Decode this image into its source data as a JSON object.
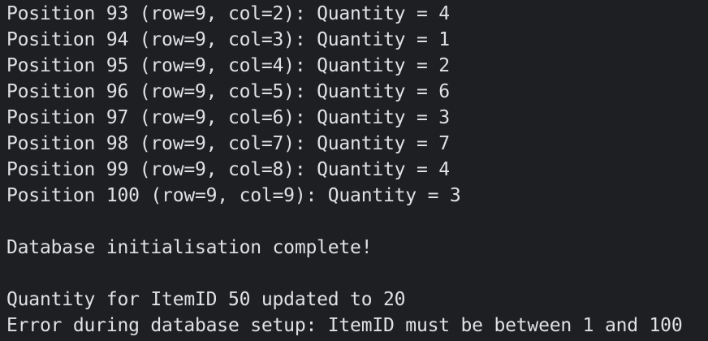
{
  "console": {
    "lines": [
      "Position 93 (row=9, col=2): Quantity = 4",
      "Position 94 (row=9, col=3): Quantity = 1",
      "Position 95 (row=9, col=4): Quantity = 2",
      "Position 96 (row=9, col=5): Quantity = 6",
      "Position 97 (row=9, col=6): Quantity = 3",
      "Position 98 (row=9, col=7): Quantity = 7",
      "Position 99 (row=9, col=8): Quantity = 4",
      "Position 100 (row=9, col=9): Quantity = 3",
      "",
      "Database initialisation complete!",
      "",
      "Quantity for ItemID 50 updated to 20",
      "Error during database setup: ItemID must be between 1 and 100"
    ],
    "colors": {
      "background": "#1e1f22",
      "text": "#dfe1e5"
    }
  }
}
